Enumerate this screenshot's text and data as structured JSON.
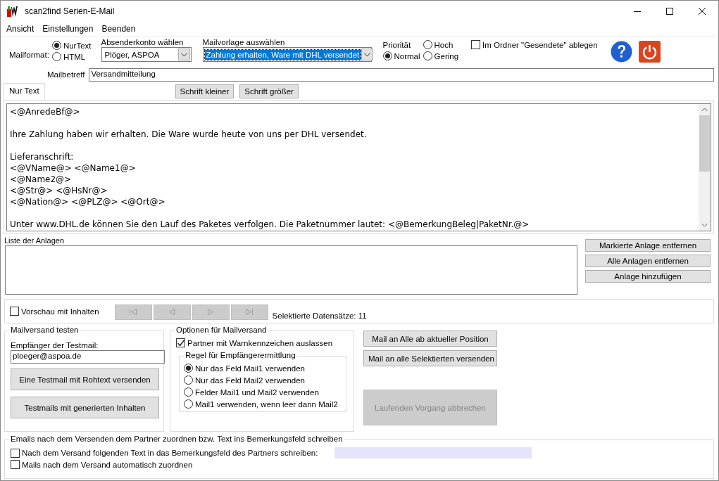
{
  "window": {
    "title": "scan2find Serien-E-Mail"
  },
  "menu": [
    "Ansicht",
    "Einstellungen",
    "Beenden"
  ],
  "mailformat": {
    "label": "Mailformat:",
    "options": [
      {
        "label": "NurText",
        "selected": true
      },
      {
        "label": "HTML",
        "selected": false
      }
    ]
  },
  "sender": {
    "label": "Absenderkonto wählen",
    "value": "Plöger, ASPOA"
  },
  "template": {
    "label": "Mailvorlage auswählen",
    "value": "Zahlung erhalten, Ware mit DHL versendet"
  },
  "priority": {
    "label": "Priorität",
    "options": [
      {
        "label": "Hoch",
        "selected": false
      },
      {
        "label": "Normal",
        "selected": true
      },
      {
        "label": "Gering",
        "selected": false
      }
    ]
  },
  "save_sent": {
    "label": "Im Ordner \"Gesendete\" ablegen",
    "checked": false
  },
  "subject": {
    "label": "Mailbetreff",
    "value": "Versandmitteilung"
  },
  "tabs": [
    {
      "label": "Nur Text",
      "selected": true
    }
  ],
  "font_buttons": [
    "Schrift kleiner",
    "Schrift größer"
  ],
  "body": "<@AnredeBf@>\n\nIhre Zahlung haben wir erhalten. Die Ware wurde heute von uns per DHL versendet.\n\nLieferanschrift:\n<@VName@> <@Name1@>\n<@Name2@>\n<@Str@> <@HsNr@>\n<@Nation@> <@PLZ@> <@Ort@>\n\nUnter www.DHL.de können Sie den Lauf des Paketes verfolgen. Die Paketnummer lautet: <@BemerkungBeleg|PaketNr.@>",
  "attachments": {
    "label": "Liste der Anlagen",
    "buttons": [
      "Markierte Anlage entfernen",
      "Alle Anlagen entfernen",
      "Anlage hinzufügen"
    ]
  },
  "preview": {
    "label": "Vorschau mit Inhalten",
    "checked": false,
    "nav_disabled": true,
    "count": "Selektierte Datensätze: 11"
  },
  "test": {
    "title": "Mailversand testen",
    "recipient_label": "Empfänger der Testmail:",
    "recipient": "ploeger@aspoa.de",
    "buttons": [
      "Eine Testmail mit Rohtext versenden",
      "Testmails mit generierten Inhalten"
    ]
  },
  "options": {
    "title": "Optionen für Mailversand",
    "skip_warn": {
      "label": "Partner mit Warnkennzeichen auslassen",
      "checked": true
    },
    "rule": {
      "title": "Regel für Empfängerermittlung",
      "options": [
        {
          "label": "Nur das Feld Mail1 verwenden",
          "selected": true
        },
        {
          "label": "Nur das Feld Mail2 verwenden",
          "selected": false
        },
        {
          "label": "Felder Mail1 und Mail2 verwenden",
          "selected": false
        },
        {
          "label": "Mail1 verwenden, wenn leer dann Mail2",
          "selected": false
        }
      ]
    }
  },
  "send_buttons": [
    {
      "label": "Mail an Alle ab aktueller Position",
      "disabled": false
    },
    {
      "label": "Mail an alle Selektierten versenden",
      "disabled": false
    },
    {
      "label": "Laufenden Vorgang abbrechen",
      "disabled": true
    }
  ],
  "assign": {
    "title": "Emails nach dem Versenden dem Partner zuordnen bzw. Text ins Bemerkungsfeld schreiben",
    "options": [
      {
        "label": "Nach dem Versand folgenden Text in das Bemerkungsfeld des Partners schreiben:",
        "checked": false
      },
      {
        "label": "Mails nach dem Versand automatisch zuordnen",
        "checked": false
      }
    ]
  }
}
